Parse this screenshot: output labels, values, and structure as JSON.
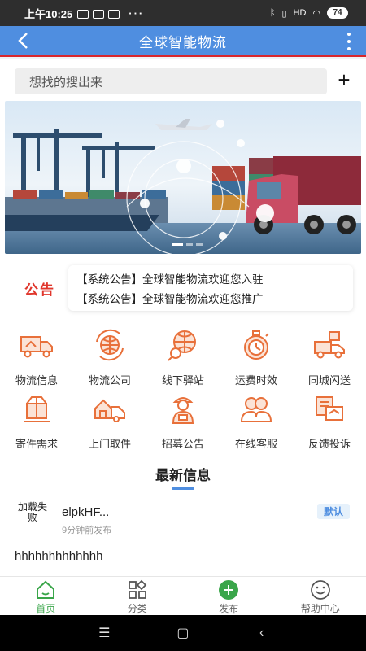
{
  "status_bar": {
    "time": "上午10:25",
    "dots": "···",
    "net_label": "HD",
    "battery": "74"
  },
  "nav": {
    "title": "全球智能物流",
    "back_glyph": "<"
  },
  "search": {
    "placeholder": "想找的搜出来",
    "add_glyph": "+"
  },
  "notice": {
    "tag": "公告",
    "lines": [
      "【系统公告】全球智能物流欢迎您入驻",
      "【系统公告】全球智能物流欢迎您推广"
    ]
  },
  "grid": [
    {
      "label": "物流信息",
      "icon": "truck-icon"
    },
    {
      "label": "物流公司",
      "icon": "globe-refresh-icon"
    },
    {
      "label": "线下驿站",
      "icon": "globe-search-icon"
    },
    {
      "label": "运费时效",
      "icon": "stopwatch-icon"
    },
    {
      "label": "同城闪送",
      "icon": "delivery-truck-icon"
    },
    {
      "label": "寄件需求",
      "icon": "parcel-icon"
    },
    {
      "label": "上门取件",
      "icon": "home-truck-icon"
    },
    {
      "label": "招募公告",
      "icon": "courier-icon"
    },
    {
      "label": "在线客服",
      "icon": "customer-service-icon"
    },
    {
      "label": "反馈投诉",
      "icon": "feedback-box-icon"
    }
  ],
  "latest": {
    "title": "最新信息",
    "post": {
      "thumb_text": "加载失败",
      "name": "elpkHF...",
      "time": "9分钟前发布",
      "badge": "默认",
      "body": "hhhhhhhhhhhhh"
    }
  },
  "tabs": [
    {
      "label": "首页",
      "icon": "home-icon",
      "active": true
    },
    {
      "label": "分类",
      "icon": "category-icon",
      "active": false
    },
    {
      "label": "发布",
      "icon": "add-circle-icon",
      "active": false
    },
    {
      "label": "帮助中心",
      "icon": "smiley-icon",
      "active": false
    }
  ],
  "colors": {
    "nav_blue": "#4f8ee0",
    "accent_orange": "#e8703a",
    "notice_red": "#e0362c",
    "tab_green": "#3aa64a"
  }
}
